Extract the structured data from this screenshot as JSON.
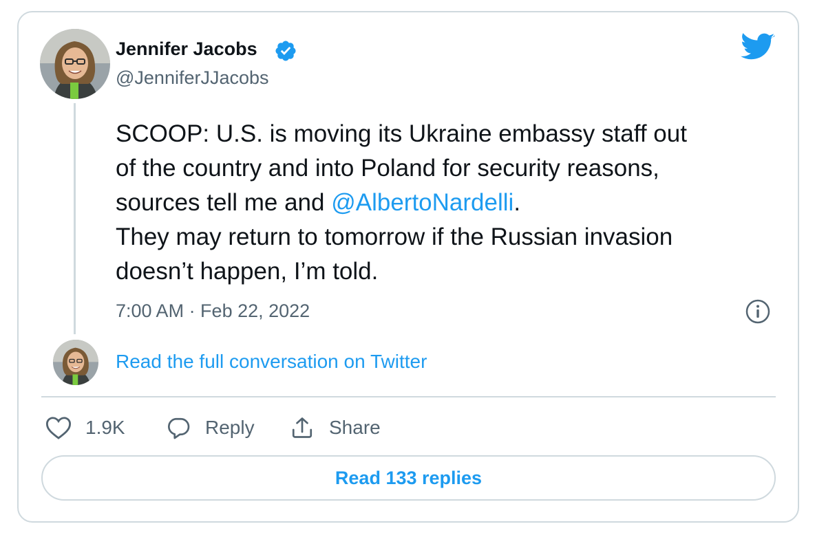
{
  "author": {
    "display_name": "Jennifer Jacobs",
    "handle": "@JenniferJJacobs",
    "verified": true
  },
  "tweet": {
    "text_line1": "SCOOP: U.S. is moving its Ukraine embassy staff out",
    "text_line2": "of the country and into Poland for security reasons,",
    "text_line3_prefix": "sources tell me and ",
    "mention": "@AlbertoNardelli",
    "text_line3_suffix": ".",
    "text_line4": "They may return to tomorrow if the Russian invasion",
    "text_line5": "doesn’t happen, I’m told.",
    "timestamp": "7:00 AM · Feb 22, 2022"
  },
  "conversation_link": "Read the full conversation on Twitter",
  "actions": {
    "like_count": "1.9K",
    "reply_label": "Reply",
    "share_label": "Share"
  },
  "read_replies_label": "Read 133 replies",
  "colors": {
    "brand_blue": "#1d9bf0",
    "text_primary": "#0f1419",
    "text_secondary": "#536471",
    "border": "#cfd9de"
  },
  "icons": [
    "twitter-bird-icon",
    "verified-badge-icon",
    "info-icon",
    "heart-icon",
    "reply-bubble-icon",
    "share-icon"
  ]
}
